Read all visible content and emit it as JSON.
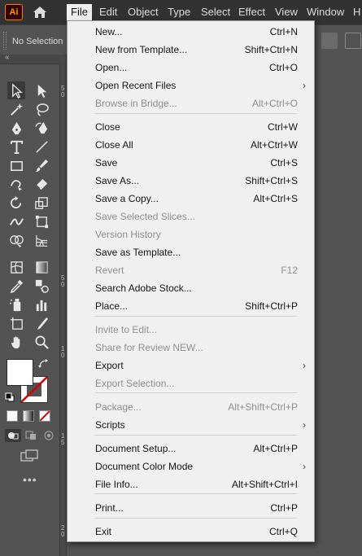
{
  "app": {
    "logo_text": "Ai"
  },
  "menubar": {
    "items": [
      {
        "label": "File"
      },
      {
        "label": "Edit"
      },
      {
        "label": "Object"
      },
      {
        "label": "Type"
      },
      {
        "label": "Select"
      },
      {
        "label": "Effect"
      },
      {
        "label": "View"
      },
      {
        "label": "Window"
      },
      {
        "label": "H"
      }
    ]
  },
  "controlbar": {
    "selection_label": "No Selection"
  },
  "ruler": {
    "marks": [
      "5\n0",
      "5\n0",
      "1\n0",
      "1\n5",
      "2\n0"
    ]
  },
  "file_menu": {
    "items": [
      {
        "label": "New...",
        "shortcut": "Ctrl+N",
        "enabled": true
      },
      {
        "label": "New from Template...",
        "shortcut": "Shift+Ctrl+N",
        "enabled": true
      },
      {
        "label": "Open...",
        "shortcut": "Ctrl+O",
        "enabled": true
      },
      {
        "label": "Open Recent Files",
        "shortcut": "",
        "enabled": true,
        "submenu": true
      },
      {
        "label": "Browse in Bridge...",
        "shortcut": "Alt+Ctrl+O",
        "enabled": false
      },
      {
        "label": "Close",
        "shortcut": "Ctrl+W",
        "enabled": true
      },
      {
        "label": "Close All",
        "shortcut": "Alt+Ctrl+W",
        "enabled": true
      },
      {
        "label": "Save",
        "shortcut": "Ctrl+S",
        "enabled": true
      },
      {
        "label": "Save As...",
        "shortcut": "Shift+Ctrl+S",
        "enabled": true
      },
      {
        "label": "Save a Copy...",
        "shortcut": "Alt+Ctrl+S",
        "enabled": true
      },
      {
        "label": "Save Selected Slices...",
        "shortcut": "",
        "enabled": false
      },
      {
        "label": "Version History",
        "shortcut": "",
        "enabled": false
      },
      {
        "label": "Save as Template...",
        "shortcut": "",
        "enabled": true
      },
      {
        "label": "Revert",
        "shortcut": "F12",
        "enabled": false
      },
      {
        "label": "Search Adobe Stock...",
        "shortcut": "",
        "enabled": true
      },
      {
        "label": "Place...",
        "shortcut": "Shift+Ctrl+P",
        "enabled": true
      },
      {
        "label": "Invite to Edit...",
        "shortcut": "",
        "enabled": false
      },
      {
        "label": "Share for Review NEW...",
        "shortcut": "",
        "enabled": false
      },
      {
        "label": "Export",
        "shortcut": "",
        "enabled": true,
        "submenu": true
      },
      {
        "label": "Export Selection...",
        "shortcut": "",
        "enabled": false
      },
      {
        "label": "Package...",
        "shortcut": "Alt+Shift+Ctrl+P",
        "enabled": false
      },
      {
        "label": "Scripts",
        "shortcut": "",
        "enabled": true,
        "submenu": true
      },
      {
        "label": "Document Setup...",
        "shortcut": "Alt+Ctrl+P",
        "enabled": true
      },
      {
        "label": "Document Color Mode",
        "shortcut": "",
        "enabled": true,
        "submenu": true
      },
      {
        "label": "File Info...",
        "shortcut": "Alt+Shift+Ctrl+I",
        "enabled": true
      },
      {
        "label": "Print...",
        "shortcut": "Ctrl+P",
        "enabled": true
      },
      {
        "label": "Exit",
        "shortcut": "Ctrl+Q",
        "enabled": true
      }
    ]
  },
  "colors": {
    "menubar_bg": "#323232",
    "menu_bg": "#f0f0f0",
    "ui_bg": "#535353",
    "disabled_text": "#8f8f8f",
    "logo_accent": "#ff9a00"
  },
  "icons": {
    "submenu_arrow": "›",
    "collapse": "«"
  }
}
